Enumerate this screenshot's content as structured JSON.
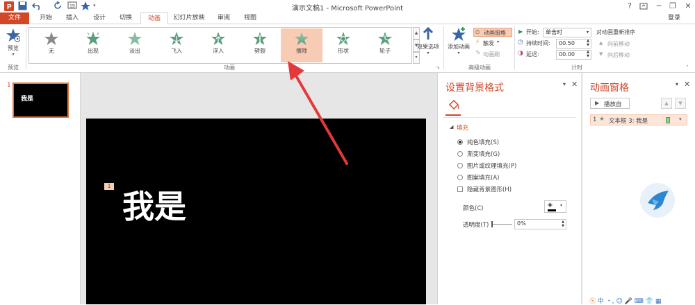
{
  "window": {
    "title": "演示文稿1 - Microsoft PowerPoint",
    "help": "?",
    "signin": "登录"
  },
  "tabs": [
    "文件",
    "开始",
    "插入",
    "设计",
    "切换",
    "动画",
    "幻灯片放映",
    "审阅",
    "视图"
  ],
  "active_tab": "动画",
  "ribbon": {
    "preview_label": "预览",
    "preview_group": "预览",
    "animations": [
      {
        "label": "无",
        "color": "#8a8a8a"
      },
      {
        "label": "出现",
        "color": "#5a9e7e"
      },
      {
        "label": "淡出",
        "color": "#5a9e7e"
      },
      {
        "label": "飞入",
        "color": "#5a9e7e"
      },
      {
        "label": "浮入",
        "color": "#5a9e7e"
      },
      {
        "label": "劈裂",
        "color": "#5a9e7e"
      },
      {
        "label": "擦除",
        "color": "#5a9e7e"
      },
      {
        "label": "形状",
        "color": "#5a9e7e"
      },
      {
        "label": "轮子",
        "color": "#5a9e7e"
      }
    ],
    "selected_animation": "擦除",
    "effect_options": "效果选项",
    "animation_group": "动画",
    "add_animation": "添加动画",
    "anim_pane_btn": "动画窗格",
    "trigger": "触发",
    "anim_painter": "动画刷",
    "advanced_group": "高级动画",
    "start_label": "开始:",
    "start_value": "单击时",
    "duration_label": "持续时间:",
    "duration_value": "00.50",
    "delay_label": "延迟:",
    "delay_value": "00.00",
    "reorder_title": "对动画重新排序",
    "move_earlier": "向前移动",
    "move_later": "向后移动",
    "timing_group": "计时"
  },
  "thumbs": {
    "number": "1",
    "text": "我是"
  },
  "slide": {
    "badge": "1",
    "text": "我是"
  },
  "bg_pane": {
    "title": "设置背景格式",
    "section": "填充",
    "options": [
      "纯色填充(S)",
      "渐变填充(G)",
      "图片或纹理填充(P)",
      "图案填充(A)"
    ],
    "hide_graphics": "隐藏背景图形(H)",
    "color_label": "颜色(C)",
    "transparency_label": "透明度(T)",
    "transparency_value": "0%"
  },
  "anim_pane": {
    "title": "动画窗格",
    "play_from": "播放自",
    "item_number": "1",
    "item_label": "文本框 3: 我是"
  },
  "colors": {
    "accent": "#d24726",
    "selected_bg": "#f8cbb4",
    "arrow": "#e5383b"
  }
}
